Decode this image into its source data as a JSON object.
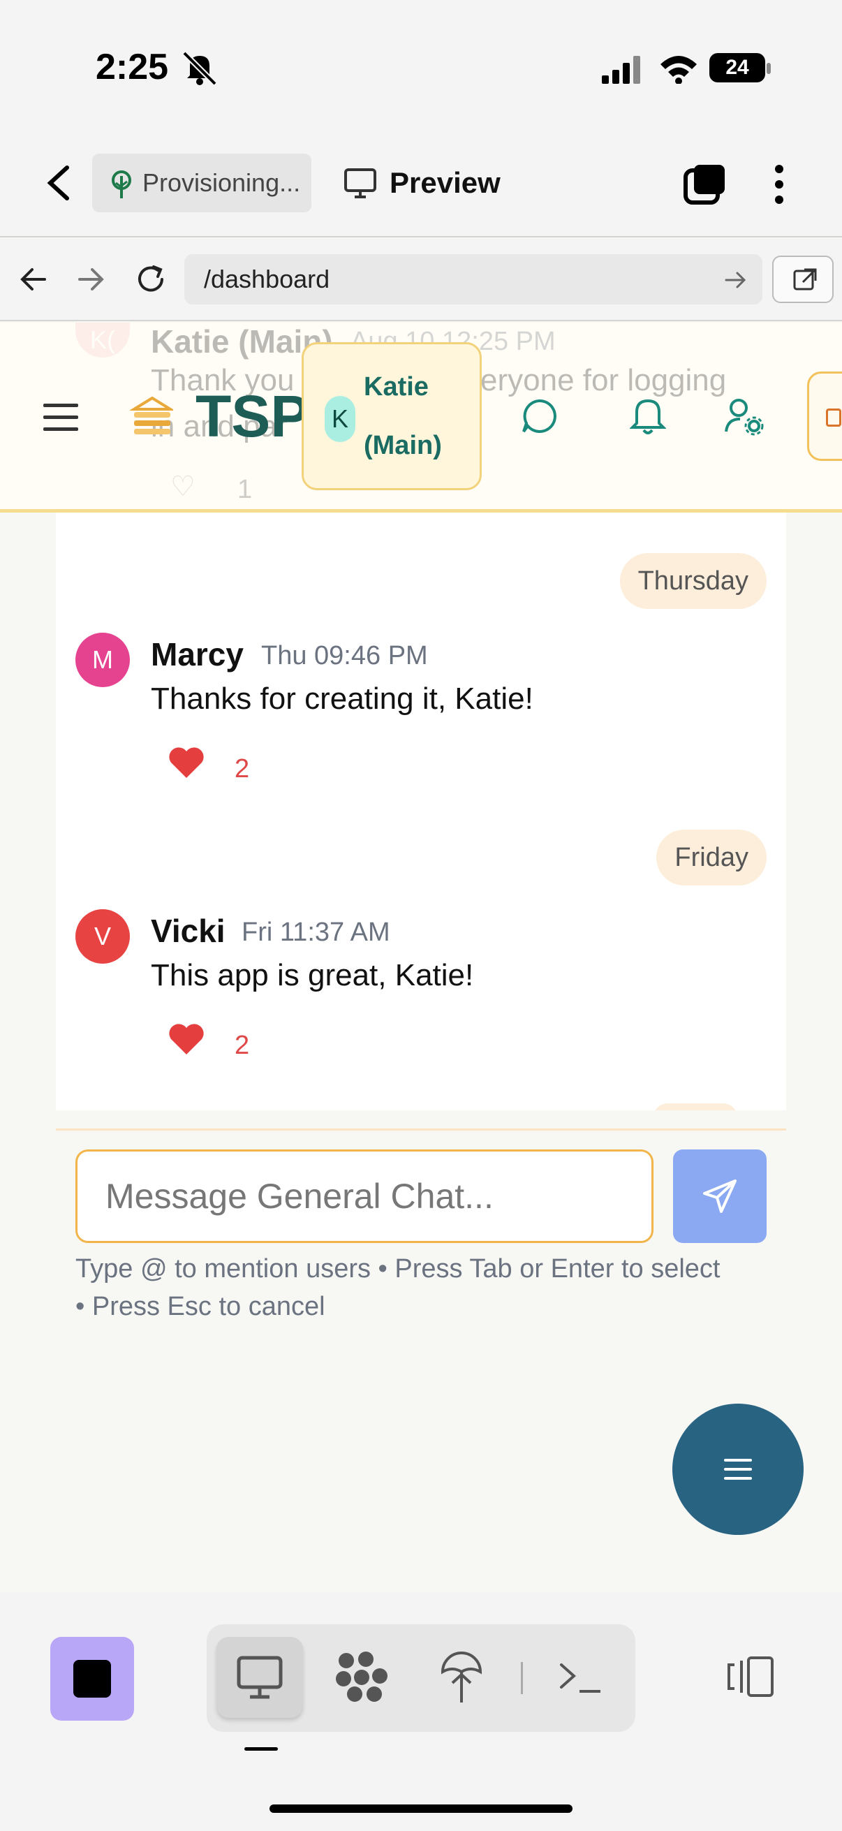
{
  "status_bar": {
    "time": "2:25",
    "battery": "24"
  },
  "app_bar": {
    "project_label": "Provisioning...",
    "preview_label": "Preview"
  },
  "url_bar": {
    "path": "/dashboard"
  },
  "header": {
    "brand": "TSP",
    "user_initial": "K",
    "user_name_line1": "Katie",
    "user_name_line2": "(Main)",
    "bg_message": {
      "avatar": "K(",
      "author": "Katie (Main)",
      "time": "Aug 10 12:25 PM",
      "text_a": "Thank you",
      "text_b": "eryone for logging",
      "text_c": "in and par",
      "likes": "1"
    }
  },
  "chat": {
    "messages": [
      {
        "day": "Thursday",
        "initial": "M",
        "author": "Marcy",
        "time": "Thu 09:46 PM",
        "text": "Thanks for creating it, Katie!",
        "likes": "2",
        "avatar_color": "#e5428f"
      },
      {
        "day": "Friday",
        "initial": "V",
        "author": "Vicki",
        "time": "Fri 11:37 AM",
        "text": "This app is great, Katie!",
        "likes": "2",
        "avatar_color": "#e84343"
      }
    ],
    "input_placeholder": "Message General Chat...",
    "hint_line1": "Type @ to mention users • Press Tab or Enter to select",
    "hint_line2": "• Press Esc to cancel"
  },
  "colors": {
    "accent": "#1a7f72",
    "fab": "#286382",
    "send": "#8ba8f2",
    "border_accent": "#f2b54a"
  }
}
